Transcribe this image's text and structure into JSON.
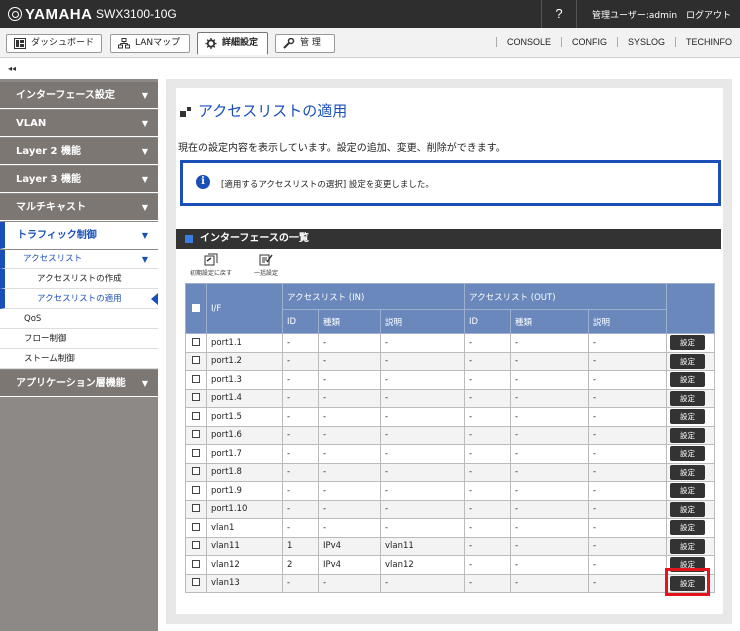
{
  "header": {
    "brand": "YAMAHA",
    "model": "SWX3100-10G",
    "help": "?",
    "user_label": "管理ユーザー:",
    "user_name": "admin",
    "logout": "ログアウト"
  },
  "toolbar": {
    "tabs": [
      {
        "label": "ダッシュボード"
      },
      {
        "label": "LANマップ"
      },
      {
        "label": "詳細設定"
      },
      {
        "label": "管 理"
      }
    ],
    "links": [
      "CONSOLE",
      "CONFIG",
      "SYSLOG",
      "TECHINFO"
    ],
    "collapse": "◂◂"
  },
  "sidebar": {
    "sections": [
      {
        "label": "インターフェース設定",
        "arrow": "▼"
      },
      {
        "label": "VLAN",
        "arrow": "▼"
      },
      {
        "label": "Layer 2 機能",
        "arrow": "▼"
      },
      {
        "label": "Layer 3 機能",
        "arrow": "▼"
      },
      {
        "label": "マルチキャスト",
        "arrow": "▼"
      },
      {
        "label": "トラフィック制御",
        "arrow": "▼"
      },
      {
        "label": "アプリケーション層機能",
        "arrow": "▼"
      }
    ],
    "sub": {
      "acl": "アクセスリスト",
      "acl_arrow": "▼",
      "acl_create": "アクセスリストの作成",
      "acl_apply": "アクセスリストの適用",
      "qos": "QoS",
      "flow": "フロー制御",
      "storm": "ストーム制御"
    }
  },
  "page": {
    "title": "アクセスリストの適用",
    "description": "現在の設定内容を表示しています。設定の追加、変更、削除ができます。",
    "notice": "[適用するアクセスリストの選択] 設定を変更しました。",
    "section_title": "インターフェースの一覧",
    "tools": {
      "reset": "初期設定に戻す",
      "bulk": "一括設定"
    }
  },
  "table": {
    "headers": {
      "if": "I/F",
      "in": "アクセスリスト (IN)",
      "out": "アクセスリスト (OUT)",
      "id": "ID",
      "type": "種類",
      "desc": "説明"
    },
    "button_label": "設定",
    "rows": [
      {
        "if": "port1.1",
        "in_id": "-",
        "in_type": "-",
        "in_desc": "-",
        "out_id": "-",
        "out_type": "-",
        "out_desc": "-"
      },
      {
        "if": "port1.2",
        "in_id": "-",
        "in_type": "-",
        "in_desc": "-",
        "out_id": "-",
        "out_type": "-",
        "out_desc": "-"
      },
      {
        "if": "port1.3",
        "in_id": "-",
        "in_type": "-",
        "in_desc": "-",
        "out_id": "-",
        "out_type": "-",
        "out_desc": "-"
      },
      {
        "if": "port1.4",
        "in_id": "-",
        "in_type": "-",
        "in_desc": "-",
        "out_id": "-",
        "out_type": "-",
        "out_desc": "-"
      },
      {
        "if": "port1.5",
        "in_id": "-",
        "in_type": "-",
        "in_desc": "-",
        "out_id": "-",
        "out_type": "-",
        "out_desc": "-"
      },
      {
        "if": "port1.6",
        "in_id": "-",
        "in_type": "-",
        "in_desc": "-",
        "out_id": "-",
        "out_type": "-",
        "out_desc": "-"
      },
      {
        "if": "port1.7",
        "in_id": "-",
        "in_type": "-",
        "in_desc": "-",
        "out_id": "-",
        "out_type": "-",
        "out_desc": "-"
      },
      {
        "if": "port1.8",
        "in_id": "-",
        "in_type": "-",
        "in_desc": "-",
        "out_id": "-",
        "out_type": "-",
        "out_desc": "-"
      },
      {
        "if": "port1.9",
        "in_id": "-",
        "in_type": "-",
        "in_desc": "-",
        "out_id": "-",
        "out_type": "-",
        "out_desc": "-"
      },
      {
        "if": "port1.10",
        "in_id": "-",
        "in_type": "-",
        "in_desc": "-",
        "out_id": "-",
        "out_type": "-",
        "out_desc": "-"
      },
      {
        "if": "vlan1",
        "in_id": "-",
        "in_type": "-",
        "in_desc": "-",
        "out_id": "-",
        "out_type": "-",
        "out_desc": "-"
      },
      {
        "if": "vlan11",
        "in_id": "1",
        "in_type": "IPv4",
        "in_desc": "vlan11",
        "out_id": "-",
        "out_type": "-",
        "out_desc": "-"
      },
      {
        "if": "vlan12",
        "in_id": "2",
        "in_type": "IPv4",
        "in_desc": "vlan12",
        "out_id": "-",
        "out_type": "-",
        "out_desc": "-"
      },
      {
        "if": "vlan13",
        "in_id": "-",
        "in_type": "-",
        "in_desc": "-",
        "out_id": "-",
        "out_type": "-",
        "out_desc": "-"
      }
    ]
  },
  "colors": {
    "accent": "#1a4fb8",
    "table_header": "#6b88bc",
    "highlight": "#e3141b"
  }
}
